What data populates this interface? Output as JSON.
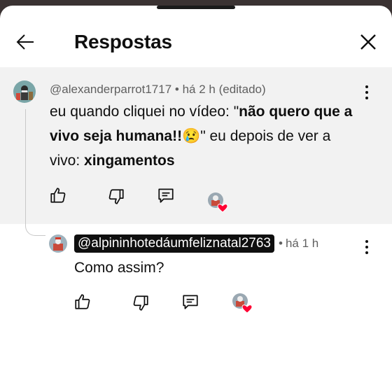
{
  "header": {
    "title": "Respostas"
  },
  "parent_comment": {
    "author": "@alexanderparrot1717",
    "time": "há 2 h",
    "edited": "(editado)",
    "text_before": "eu quando cliquei no vídeo: \"",
    "text_bold_1": "não quero que a vivo seja humana!!😢",
    "text_middle": "\" eu depois de ver a vivo: ",
    "text_bold_2": "xingamentos"
  },
  "reply_comment": {
    "author": "@alpininhotedáumfeliznatal2763",
    "time": "há 1 h",
    "text": "Como assim?"
  },
  "colors": {
    "parent_bg": "#f2f2f2",
    "heart": "#ff0033"
  },
  "icons": {
    "back": "arrow-left-icon",
    "close": "close-icon",
    "like": "thumbs-up-icon",
    "dislike": "thumbs-down-icon",
    "reply": "reply-icon",
    "heart": "creator-heart-icon",
    "more": "more-vertical-icon"
  }
}
